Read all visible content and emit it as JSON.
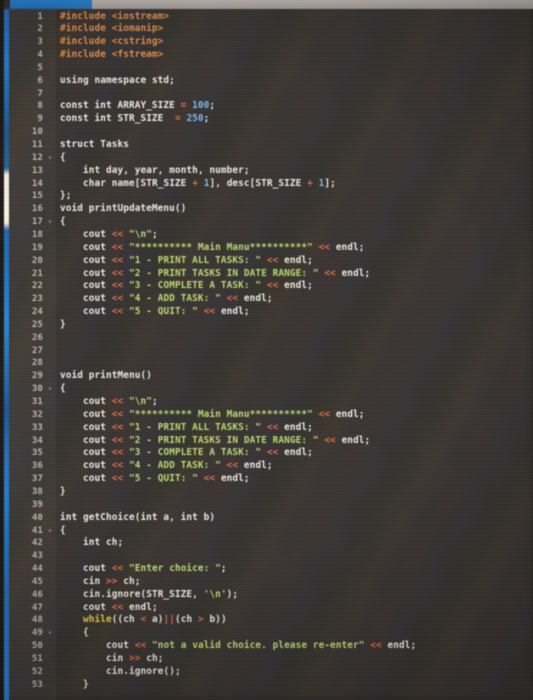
{
  "window": {
    "title": "code-editor-screenshot",
    "language": "C++",
    "theme": "dark",
    "capture_type": "photo-of-monitor"
  },
  "chrome": {
    "top_bar_color": "#1b7ad4",
    "top_strip_color": "#a9a29c",
    "left_strip_color": "#1b7ad4"
  },
  "colors": {
    "background": "#2b2724",
    "gutter": "#332e2a",
    "line_number": "#b9b0a8",
    "default_text": "#e8e2da",
    "preprocessor": "#e2893f",
    "number": "#79b6e8",
    "operator": "#e0663c",
    "string": "#b7d86a",
    "control_keyword": "#e8c84a"
  },
  "editor": {
    "first_line": 1,
    "last_line": 53,
    "fold_markers": [
      12,
      17,
      30,
      41,
      49
    ],
    "lines": [
      {
        "n": 1,
        "text": "#include <iostream>"
      },
      {
        "n": 2,
        "text": "#include <iomanip>"
      },
      {
        "n": 3,
        "text": "#include <cstring>"
      },
      {
        "n": 4,
        "text": "#include <fstream>"
      },
      {
        "n": 5,
        "text": ""
      },
      {
        "n": 6,
        "text": "using namespace std;"
      },
      {
        "n": 7,
        "text": ""
      },
      {
        "n": 8,
        "text": "const int ARRAY_SIZE = 100;"
      },
      {
        "n": 9,
        "text": "const int STR_SIZE  = 250;"
      },
      {
        "n": 10,
        "text": ""
      },
      {
        "n": 11,
        "text": "struct Tasks"
      },
      {
        "n": 12,
        "text": "{"
      },
      {
        "n": 13,
        "text": "    int day, year, month, number;"
      },
      {
        "n": 14,
        "text": "    char name[STR_SIZE + 1], desc[STR_SIZE + 1];"
      },
      {
        "n": 15,
        "text": "};"
      },
      {
        "n": 16,
        "text": "void printUpdateMenu()"
      },
      {
        "n": 17,
        "text": "{"
      },
      {
        "n": 18,
        "text": "    cout << \"\\n\";"
      },
      {
        "n": 19,
        "text": "    cout << \"********** Main Manu**********\" << endl;"
      },
      {
        "n": 20,
        "text": "    cout << \"1 - PRINT ALL TASKS: \" << endl;"
      },
      {
        "n": 21,
        "text": "    cout << \"2 - PRINT TASKS IN DATE RANGE: \" << endl;"
      },
      {
        "n": 22,
        "text": "    cout << \"3 - COMPLETE A TASK: \" << endl;"
      },
      {
        "n": 23,
        "text": "    cout << \"4 - ADD TASK: \" << endl;"
      },
      {
        "n": 24,
        "text": "    cout << \"5 - QUIT: \" << endl;"
      },
      {
        "n": 25,
        "text": "}"
      },
      {
        "n": 26,
        "text": ""
      },
      {
        "n": 27,
        "text": ""
      },
      {
        "n": 28,
        "text": ""
      },
      {
        "n": 29,
        "text": "void printMenu()"
      },
      {
        "n": 30,
        "text": "{"
      },
      {
        "n": 31,
        "text": "    cout << \"\\n\";"
      },
      {
        "n": 32,
        "text": "    cout << \"********** Main Manu**********\" << endl;"
      },
      {
        "n": 33,
        "text": "    cout << \"1 - PRINT ALL TASKS: \" << endl;"
      },
      {
        "n": 34,
        "text": "    cout << \"2 - PRINT TASKS IN DATE RANGE: \" << endl;"
      },
      {
        "n": 35,
        "text": "    cout << \"3 - COMPLETE A TASK: \" << endl;"
      },
      {
        "n": 36,
        "text": "    cout << \"4 - ADD TASK: \" << endl;"
      },
      {
        "n": 37,
        "text": "    cout << \"5 - QUIT: \" << endl;"
      },
      {
        "n": 38,
        "text": "}"
      },
      {
        "n": 39,
        "text": ""
      },
      {
        "n": 40,
        "text": "int getChoice(int a, int b)"
      },
      {
        "n": 41,
        "text": "{"
      },
      {
        "n": 42,
        "text": "    int ch;"
      },
      {
        "n": 43,
        "text": ""
      },
      {
        "n": 44,
        "text": "    cout << \"Enter choice: \";"
      },
      {
        "n": 45,
        "text": "    cin >> ch;"
      },
      {
        "n": 46,
        "text": "    cin.ignore(STR_SIZE, '\\n');"
      },
      {
        "n": 47,
        "text": "    cout << endl;"
      },
      {
        "n": 48,
        "text": "    while((ch < a)||(ch > b))"
      },
      {
        "n": 49,
        "text": "    {"
      },
      {
        "n": 50,
        "text": "        cout << \"not a valid choice. please re-enter\" << endl;"
      },
      {
        "n": 51,
        "text": "        cin >> ch;"
      },
      {
        "n": 52,
        "text": "        cin.ignore();"
      },
      {
        "n": 53,
        "text": "    }"
      }
    ]
  }
}
